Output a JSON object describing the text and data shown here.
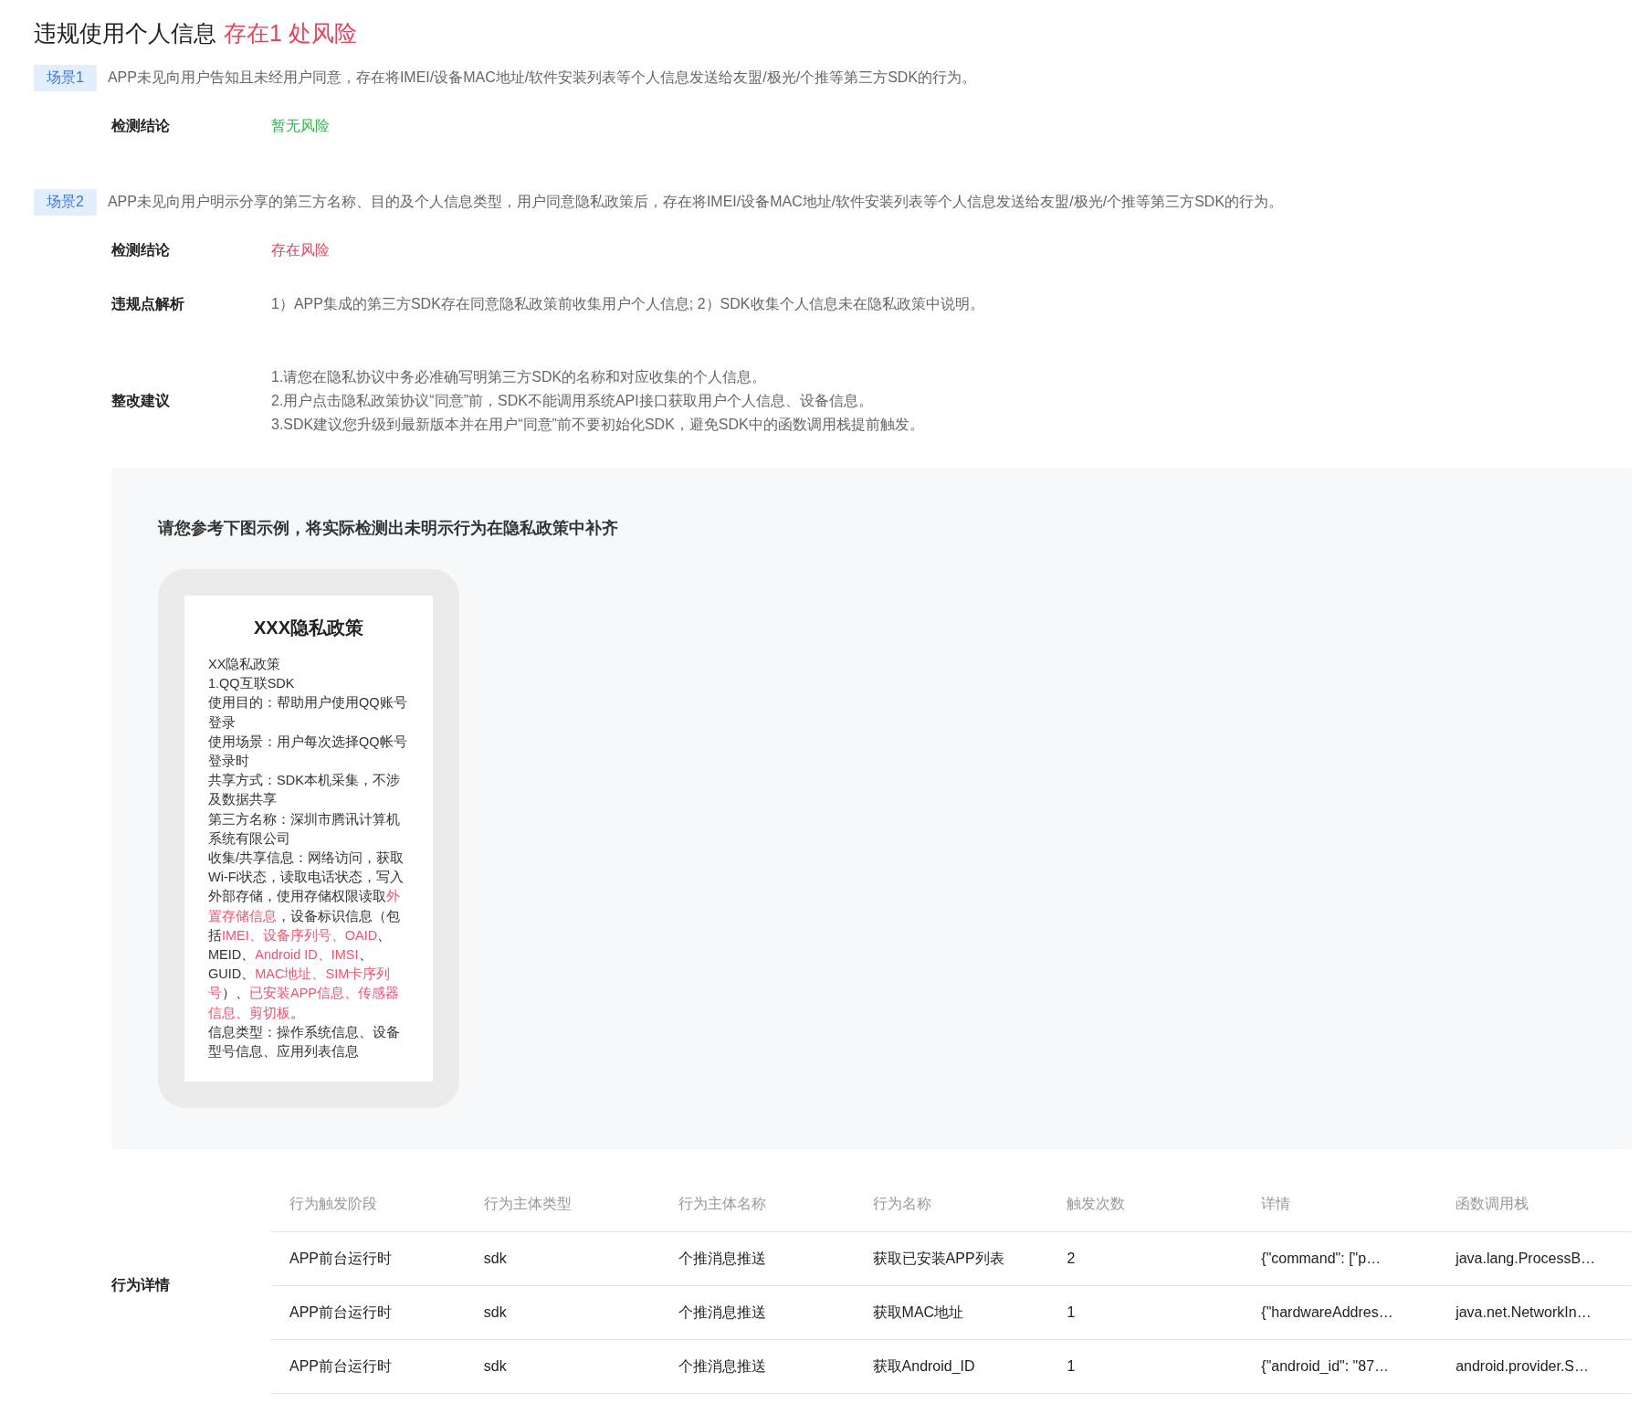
{
  "title": {
    "text": "违规使用个人信息",
    "risk_summary": "存在1 处风险"
  },
  "scenarios": [
    {
      "tag": "场景1",
      "description": "APP未见向用户告知且未经用户同意，存在将IMEI/设备MAC地址/软件安装列表等个人信息发送给友盟/极光/个推等第三方SDK的行为。",
      "fields": [
        {
          "kind": "conclusion",
          "label": "检测结论",
          "value": "暂无风险",
          "risk": false
        }
      ]
    },
    {
      "tag": "场景2",
      "description": "APP未见向用户明示分享的第三方名称、目的及个人信息类型，用户同意隐私政策后，存在将IMEI/设备MAC地址/软件安装列表等个人信息发送给友盟/极光/个推等第三方SDK的行为。",
      "fields": [
        {
          "kind": "conclusion",
          "label": "检测结论",
          "value": "存在风险",
          "risk": true
        },
        {
          "kind": "text",
          "label": "违规点解析",
          "value": "1）APP集成的第三方SDK存在同意隐私政策前收集用户个人信息; 2）SDK收集个人信息未在隐私政策中说明。"
        },
        {
          "kind": "list",
          "label": "整改建议",
          "lines": [
            "1.请您在隐私协议中务必准确写明第三方SDK的名称和对应收集的个人信息。",
            "2.用户点击隐私政策协议“同意”前，SDK不能调用系统API接口获取用户个人信息、设备信息。",
            "3.SDK建议您升级到最新版本并在用户“同意”前不要初始化SDK，避免SDK中的函数调用栈提前触发。"
          ]
        },
        {
          "kind": "example",
          "heading": "请您参考下图示例，将实际检测出未明示行为在隐私政策中补齐",
          "policy_title": "XXX隐私政策",
          "paragraphs": [
            [
              {
                "text": "XX隐私政策",
                "highlight": false
              }
            ],
            [
              {
                "text": "1.QQ互联SDK",
                "highlight": false
              }
            ],
            [
              {
                "text": "使用目的：帮助用户使用QQ账号登录",
                "highlight": false
              }
            ],
            [
              {
                "text": "使用场景：用户每次选择QQ帐号登录时",
                "highlight": false
              }
            ],
            [
              {
                "text": "共享方式：SDK本机采集，不涉及数据共享",
                "highlight": false
              }
            ],
            [
              {
                "text": "第三方名称：深圳市腾讯计算机系统有限公司",
                "highlight": false
              }
            ],
            [
              {
                "text": "收集/共享信息：网络访问，获取Wi-Fi状态，读取电话状态，写入外部存储，使用存储权限读取",
                "highlight": false
              },
              {
                "text": "外置存储信息",
                "highlight": true
              },
              {
                "text": "，设备标识信息（包括",
                "highlight": false
              },
              {
                "text": "IMEI、设备序列号、OAID",
                "highlight": true
              },
              {
                "text": "、MEID、",
                "highlight": false
              },
              {
                "text": "Android ID、IMSI",
                "highlight": true
              },
              {
                "text": "、GUID、",
                "highlight": false
              },
              {
                "text": "MAC地址、SIM卡序列号",
                "highlight": true
              },
              {
                "text": "）、",
                "highlight": false
              },
              {
                "text": "已安装APP信息、传感器信息、剪切板",
                "highlight": true
              },
              {
                "text": "。",
                "highlight": false
              }
            ],
            [
              {
                "text": "信息类型：操作系统信息、设备型号信息、应用列表信息",
                "highlight": false
              }
            ]
          ]
        },
        {
          "kind": "table",
          "label": "行为详情",
          "columns": [
            "行为触发阶段",
            "行为主体类型",
            "行为主体名称",
            "行为名称",
            "触发次数",
            "详情",
            "函数调用栈"
          ],
          "rows": [
            [
              "APP前台运行时",
              "sdk",
              "个推消息推送",
              "获取已安装APP列表",
              "2",
              "{\"command\": [\"p…",
              "java.lang.ProcessB…"
            ],
            [
              "APP前台运行时",
              "sdk",
              "个推消息推送",
              "获取MAC地址",
              "1",
              "{\"hardwareAddres…",
              "java.net.NetworkIn…"
            ],
            [
              "APP前台运行时",
              "sdk",
              "个推消息推送",
              "获取Android_ID",
              "1",
              "{\"android_id\": \"87…",
              "android.provider.S…"
            ]
          ]
        }
      ]
    }
  ]
}
